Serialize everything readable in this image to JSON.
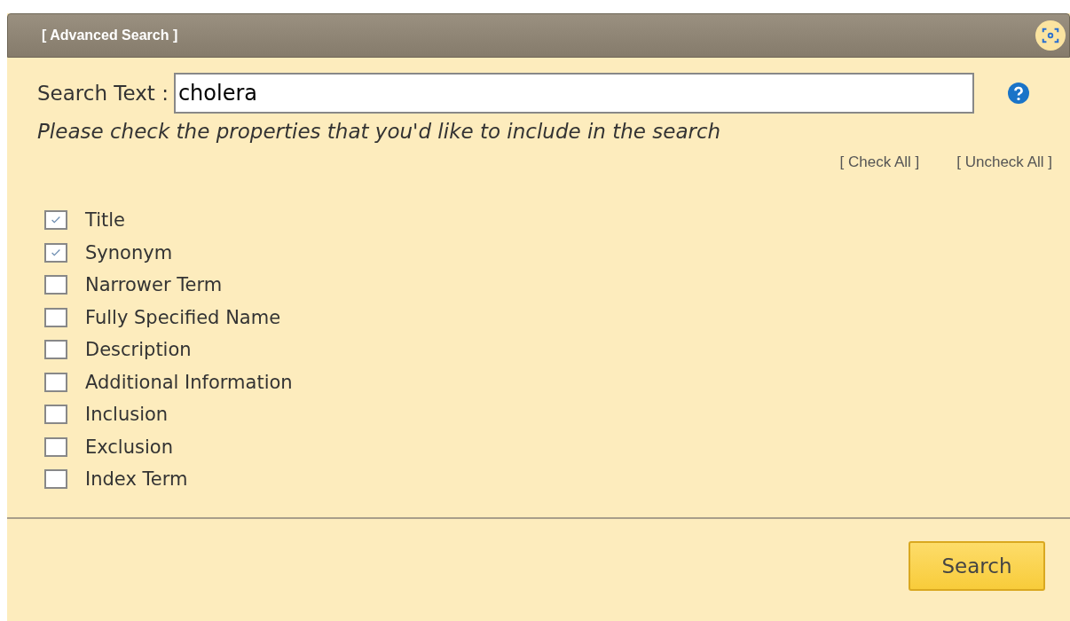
{
  "panel": {
    "title": "[ Advanced Search ]"
  },
  "search": {
    "label": "Search Text :",
    "value": "cholera"
  },
  "instruction": "Please check the properties that you'd like to include in the search",
  "links": [
    "[ Check All ]",
    "[ Uncheck All ]"
  ],
  "properties": [
    {
      "label": "Title",
      "checked": true
    },
    {
      "label": "Synonym",
      "checked": true
    },
    {
      "label": "Narrower Term",
      "checked": false
    },
    {
      "label": "Fully Specified Name",
      "checked": false
    },
    {
      "label": "Description",
      "checked": false
    },
    {
      "label": "Additional Information",
      "checked": false
    },
    {
      "label": "Inclusion",
      "checked": false
    },
    {
      "label": "Exclusion",
      "checked": false
    },
    {
      "label": "Index Term",
      "checked": false
    }
  ],
  "buttons": [
    "Search"
  ]
}
